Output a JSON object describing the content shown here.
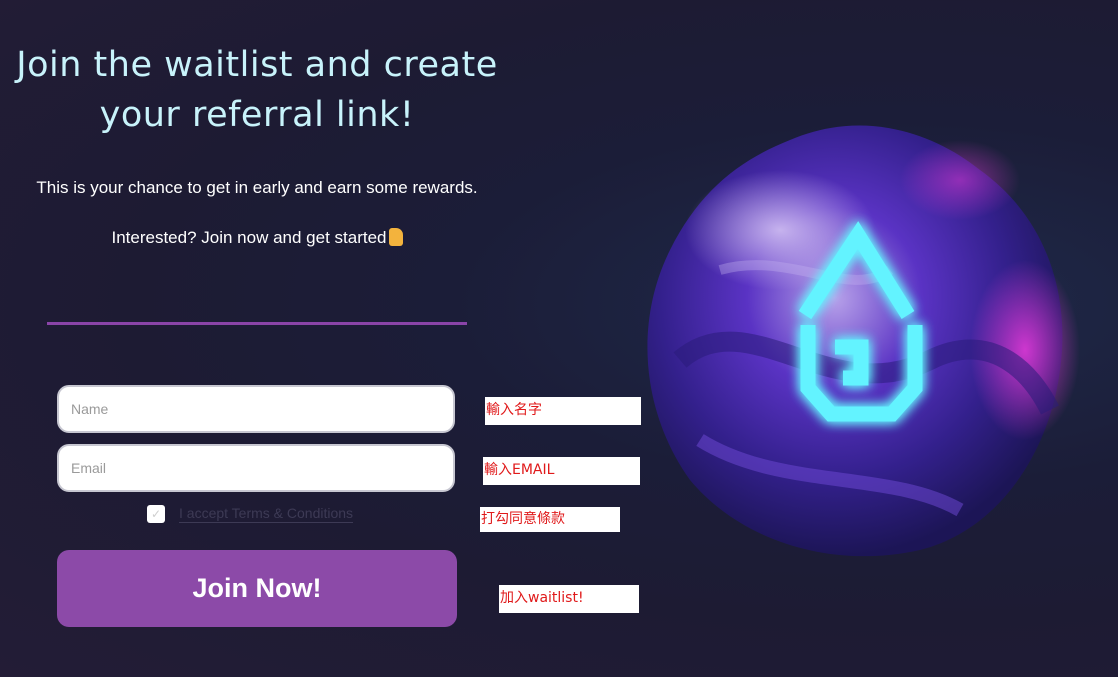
{
  "hero": {
    "title": "Join the waitlist and create your referral link!",
    "subtitle": "This is your chance to get in early and earn some rewards.",
    "cta_text": "Interested? Join now and get started",
    "cta_icon": "pointing-down-hand-icon"
  },
  "form": {
    "name_placeholder": "Name",
    "email_placeholder": "Email",
    "terms_label": "I accept Terms & Conditions",
    "terms_checked": false,
    "submit_label": "Join Now!"
  },
  "annotations": {
    "name_note": "輸入名字",
    "email_note": "輸入EMAIL",
    "terms_note": "打勾同意條款",
    "submit_note": "加入waitlist!"
  },
  "colors": {
    "title": "#c8f3fb",
    "button": "#8c4aa8",
    "divider": "#8a44a8",
    "annotation_text": "#e0191a",
    "logo_glow": "#63f3ff"
  },
  "artwork": {
    "icon": "glowing-droplet-logo-icon"
  }
}
